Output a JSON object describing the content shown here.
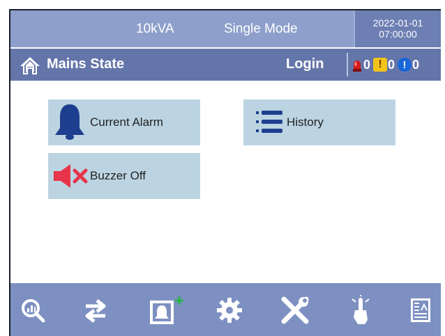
{
  "topbar": {
    "model": "10kVA",
    "mode": "Single Mode",
    "date": "2022-01-01",
    "time": "07:00:00"
  },
  "statebar": {
    "state": "Mains State",
    "login": "Login",
    "alarms": [
      {
        "icon": "red-beacon-icon",
        "count": "0"
      },
      {
        "icon": "warning-icon",
        "count": "0",
        "glyph": "!"
      },
      {
        "icon": "info-icon",
        "count": "0",
        "glyph": "!"
      }
    ]
  },
  "buttons": {
    "current_alarm": "Current Alarm",
    "history": "History",
    "buzzer_off": "Buzzer Off"
  },
  "bottom_nav": [
    "monitor-icon",
    "transfer-icon",
    "alarm-add-icon",
    "settings-gear-icon",
    "tools-icon",
    "touch-hand-icon",
    "report-icon"
  ],
  "colors": {
    "topbar": "#8e9fcb",
    "statebar": "#6475a9",
    "bottombar": "#7d90c1",
    "button": "#bcd4e2",
    "icon_dark_blue": "#1e3f8f",
    "buzzer_red": "#e8344a"
  }
}
